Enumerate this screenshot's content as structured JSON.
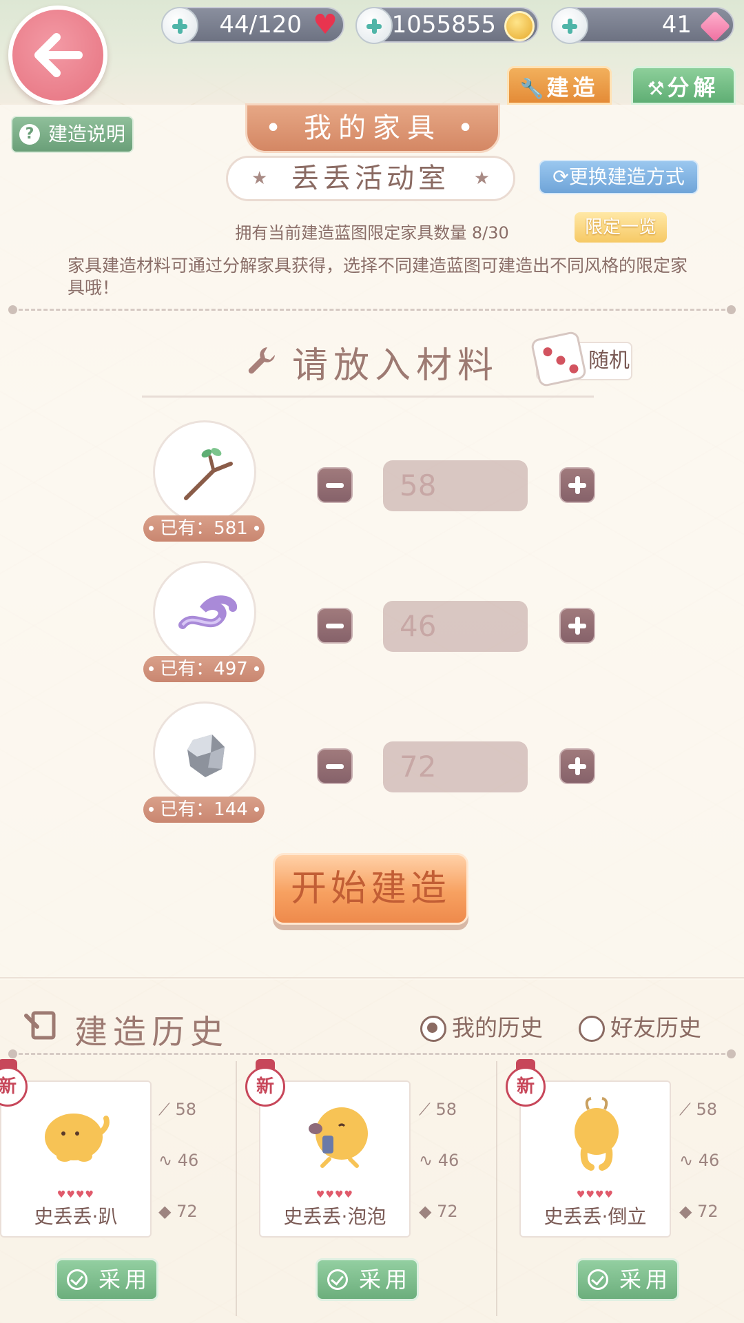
{
  "resources": {
    "energy": "44/120",
    "coins": "1055855",
    "gems": "41"
  },
  "tabs": {
    "build": "建造",
    "decompose": "分解"
  },
  "header": {
    "help_label": "建造说明",
    "title": "• 我的家具 •",
    "room_name": "丢丢活动室",
    "change_label": "更换建造方式",
    "owned_count": "拥有当前建造蓝图限定家具数量 8/30",
    "limit_label": "限定一览",
    "description": "家具建造材料可通过分解家具获得，选择不同建造蓝图可建造出不同风格的限定家具哦！"
  },
  "materials_section": {
    "title": "请放入材料",
    "random_label": "随机",
    "materials": [
      {
        "icon": "twig-icon",
        "owned": "已有：581",
        "quantity": "58"
      },
      {
        "icon": "ribbon-icon",
        "owned": "已有：497",
        "quantity": "46"
      },
      {
        "icon": "stone-icon",
        "owned": "已有：144",
        "quantity": "72"
      }
    ],
    "start_label": "开始建造"
  },
  "history": {
    "title": "建造历史",
    "filter_mine": "我的历史",
    "filter_friends": "好友历史",
    "new_label": "新",
    "adopt_label": "采用",
    "items": [
      {
        "name": "史丢丢·趴",
        "hearts": "♥♥♥♥",
        "m1": "58",
        "m2": "46",
        "m3": "72"
      },
      {
        "name": "史丢丢·泡泡",
        "hearts": "♥♥♥♥",
        "m1": "58",
        "m2": "46",
        "m3": "72"
      },
      {
        "name": "史丢丢·倒立",
        "hearts": "♥♥♥♥",
        "m1": "58",
        "m2": "46",
        "m3": "72"
      }
    ]
  },
  "colors": {
    "accent_orange": "#ee8a4c",
    "accent_green": "#6cae7c",
    "accent_pink": "#e6727f",
    "text_brown": "#7a5a55"
  }
}
